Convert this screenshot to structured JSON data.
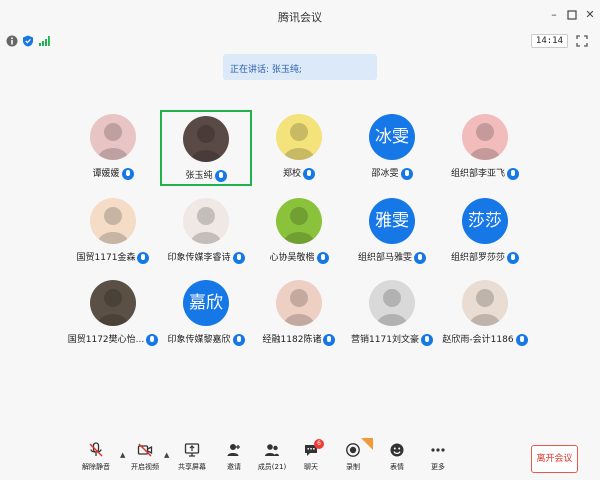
{
  "window": {
    "title": "腾讯会议",
    "clock": "14:14"
  },
  "speaking_banner": "正在讲话: 张玉纯;",
  "participants": [
    {
      "name": "谭媛媛",
      "avatar_text": "",
      "avatar_color": "#e9c4c4"
    },
    {
      "name": "张玉纯",
      "avatar_text": "",
      "avatar_color": "#5a4a45",
      "active": true
    },
    {
      "name": "郑校",
      "avatar_text": "",
      "avatar_color": "#f4e27a"
    },
    {
      "name": "邵冰雯",
      "avatar_text": "冰雯",
      "avatar_color": "#1677e6"
    },
    {
      "name": "组织部李亚飞",
      "avatar_text": "",
      "avatar_color": "#f2bcbc"
    },
    {
      "name": "国贸1171金森",
      "avatar_text": "",
      "avatar_color": "#f4dcc6"
    },
    {
      "name": "印象传媒李睿诗",
      "avatar_text": "",
      "avatar_color": "#efe8e4"
    },
    {
      "name": "心协吴敬楷",
      "avatar_text": "",
      "avatar_color": "#8ac23c"
    },
    {
      "name": "组织部马雅雯",
      "avatar_text": "雅雯",
      "avatar_color": "#1677e6"
    },
    {
      "name": "组织部罗莎莎",
      "avatar_text": "莎莎",
      "avatar_color": "#1677e6"
    },
    {
      "name": "国贸1172樊心怡...",
      "avatar_text": "",
      "avatar_color": "#5b5045"
    },
    {
      "name": "印象传媒黎嘉欣",
      "avatar_text": "嘉欣",
      "avatar_color": "#1677e6"
    },
    {
      "name": "经融1182陈诸",
      "avatar_text": "",
      "avatar_color": "#eecfc3"
    },
    {
      "name": "营销1171刘文豪",
      "avatar_text": "",
      "avatar_color": "#d9d9d9"
    },
    {
      "name": "赵欣雨-会计1186",
      "avatar_text": "",
      "avatar_color": "#e9dcd2"
    }
  ],
  "toolbar": {
    "mute": "解除静音",
    "video": "开启视频",
    "share": "共享屏幕",
    "invite": "邀请",
    "members": "成员(21)",
    "chat": "聊天",
    "chat_badge": "6",
    "record": "录制",
    "reactions": "表情",
    "more": "更多",
    "leave": "离开会议"
  },
  "colors": {
    "accent": "#1677e6",
    "active_border": "#20b24d",
    "leave": "#e0322a"
  }
}
